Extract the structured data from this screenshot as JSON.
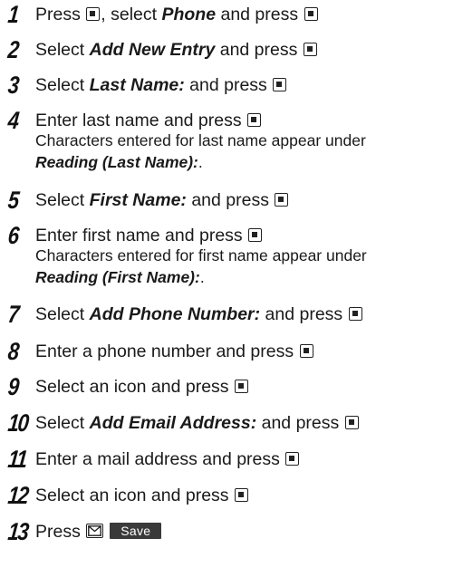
{
  "steps": [
    {
      "number": "1",
      "parts": [
        "Press ",
        "",
        ", select ",
        "Phone",
        " and press ",
        ""
      ]
    },
    {
      "number": "2",
      "parts": [
        "Select ",
        "Add New Entry",
        " and press ",
        ""
      ]
    },
    {
      "number": "3",
      "parts": [
        "Select ",
        "Last Name:",
        " and press ",
        ""
      ]
    },
    {
      "number": "4",
      "parts": [
        "Enter last name and press ",
        ""
      ],
      "note": "Characters entered for last name appear under",
      "note_em": "Reading (Last Name):",
      "note_end": "."
    },
    {
      "number": "5",
      "parts": [
        "Select ",
        "First Name:",
        " and press ",
        ""
      ]
    },
    {
      "number": "6",
      "parts": [
        "Enter first name and press ",
        ""
      ],
      "note": "Characters entered for first name appear under",
      "note_em": "Reading (First Name):",
      "note_end": "."
    },
    {
      "number": "7",
      "parts": [
        "Select ",
        "Add Phone Number:",
        " and press ",
        ""
      ]
    },
    {
      "number": "8",
      "parts": [
        "Enter a phone number and press ",
        ""
      ]
    },
    {
      "number": "9",
      "parts": [
        "Select an icon and press ",
        ""
      ]
    },
    {
      "number": "10",
      "parts": [
        "Select ",
        "Add Email Address:",
        " and press ",
        ""
      ]
    },
    {
      "number": "11",
      "parts": [
        "Enter a mail address and press ",
        ""
      ]
    },
    {
      "number": "12",
      "parts": [
        "Select an icon and press ",
        ""
      ]
    },
    {
      "number": "13",
      "parts": [
        "Press ",
        ""
      ],
      "softkey": "Save"
    }
  ],
  "icons": {
    "center_key": "center-select-key-icon",
    "mail_key": "mail-key-icon"
  },
  "colors": {
    "text": "#1a1a1a",
    "softkey_bg": "#3a3a3a",
    "softkey_text": "#ffffff"
  }
}
